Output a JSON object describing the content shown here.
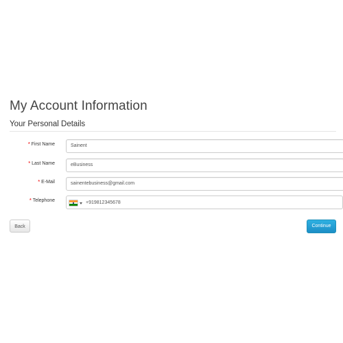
{
  "page": {
    "title": "My Account Information",
    "legend": "Your Personal Details"
  },
  "form": {
    "required_mark": "*",
    "first_name": {
      "label": "First Name",
      "value": "Sainent"
    },
    "last_name": {
      "label": "Last Name",
      "value": "eBusiness"
    },
    "email": {
      "label": "E-Mail",
      "value": "sainentebusiness@gmail.com"
    },
    "telephone": {
      "label": "Telephone",
      "value": "+919812345678",
      "flag_icon": "india-flag-icon"
    }
  },
  "buttons": {
    "back": "Back",
    "continue": "Continue"
  },
  "colors": {
    "required": "#f2383a",
    "primary": "#229ac8"
  }
}
